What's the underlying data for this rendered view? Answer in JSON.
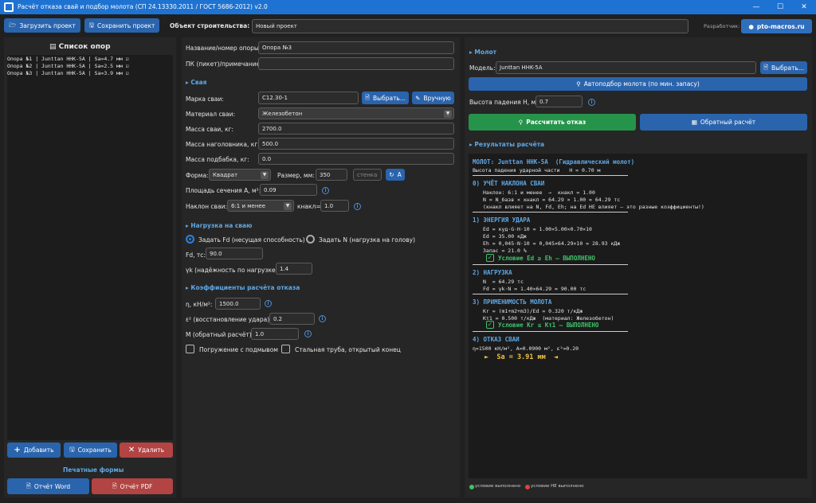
{
  "window": {
    "title": "Расчёт отказа свай и подбор молота (СП 24.13330.2011 / ГОСТ 5686-2012) v2.0",
    "minimize": "—",
    "maximize": "☐",
    "close": "✕"
  },
  "toolbar": {
    "load_label": "Загрузить проект",
    "save_label": "Сохранить проект",
    "object_label": "Объект строительства:",
    "object_value": "Новый проект",
    "dev_label": "Разработчик:",
    "site_label": "pto-macros.ru"
  },
  "left": {
    "title": "Список опор",
    "items": [
      {
        "text": "Опора №1 | Junttan HHK-5A | Sa=4.7 мм"
      },
      {
        "text": "Опора №2 | Junttan HHK-5A | Sa=2.5 мм"
      },
      {
        "text": "Опора №3 | Junttan HHK-5A | Sa=3.9 мм"
      }
    ],
    "add_label": "Добавить",
    "save_label": "Сохранить",
    "delete_label": "Удалить",
    "print_title": "Печатные формы",
    "word_label": "Отчёт Word",
    "pdf_label": "Отчёт PDF"
  },
  "middle": {
    "name_label": "Название/номер опоры:",
    "name_value": "Опора №3",
    "pk_label": "ПК (пикет)/примечание:",
    "pk_value": "",
    "pile_section": "▸ Свая",
    "brand_label": "Марка сваи:",
    "brand_value": "С12.30-1",
    "choose_label": "Выбрать...",
    "manual_label": "Вручную",
    "material_label": "Материал сваи:",
    "material_value": "Железобетон",
    "mass_label": "Масса сваи, кг:",
    "mass_value": "2700.0",
    "cap_label": "Масса наголовника, кг:",
    "cap_value": "500.0",
    "pad_label": "Масса подбабка, кг:",
    "pad_value": "0.0",
    "shape_label": "Форма:",
    "shape_value": "Квадрат",
    "size_label": "Размер, мм:",
    "size_value": "350",
    "wall_placeholder": "стенка",
    "area_btn": "A",
    "area_label": "Площадь сечения A, м²:",
    "area_value": "0.09",
    "tilt_label": "Наклон сваи:",
    "tilt_value": "6:1 и менее",
    "ktilt_label": "кнакл=",
    "ktilt_value": "1.0",
    "load_section": "▸ Нагрузка на сваю",
    "radio_fd": "Задать Fd (несущая способность)",
    "radio_n": "Задать N (нагрузка на голову)",
    "fd_label": "Fd, тс:",
    "fd_value": "90.0",
    "gk_label": "γk (надёжность по нагрузке):",
    "gk_value": "1.4",
    "coef_section": "▸ Коэффициенты расчёта отказа",
    "eta_label": "η, кН/м²:",
    "eta_value": "1500.0",
    "eps_label": "ε² (восстановление удара):",
    "eps_value": "0.2",
    "m_label": "M (обратный расчёт):",
    "m_value": "1.0",
    "chk_wash": "Погружение с подмывом",
    "chk_pipe": "Стальная труба, открытый конец"
  },
  "right": {
    "hammer_section": "▸ Молот",
    "model_label": "Модель:",
    "model_value": "Junttan HHK-5A",
    "choose_label": "Выбрать...",
    "auto_label": "Автоподбор молота (по мин. запасу)",
    "height_label": "Высота падения H, м:",
    "height_value": "0.7",
    "calc_label": "Рассчитать отказ",
    "reverse_label": "Обратный расчёт",
    "results_section": "▸ Результаты расчёта",
    "legend_ok": "условие выполнено",
    "legend_fail": "условие НЕ выполнено",
    "colors": {
      "ok": "#3fc26a",
      "fail": "#d94444",
      "accent": "#5fa8e6"
    }
  },
  "results": {
    "head1": "МОЛОТ: Junttan HHK-5A  (Гидравлический молот)",
    "head2": "Высота падения ударной части   H = 0.70 м",
    "s0": "0) УЧЁТ НАКЛОНА СВАИ",
    "s0l1": "Наклон: 6:1 и менее  →  кнакл = 1.00",
    "s0l2": "N = N_базв × кнакл = 64.29 × 1.00 = 64.29 тс",
    "s0l3": "(кнакл влияет на N, Fd, Eh; на Ed НЕ влияет — это разные коэффициенты!)",
    "s1": "1) ЭНЕРГИЯ УДАРА",
    "s1l1": "Ed = куд·G·H·10 = 1.00×5.00×0.70×10",
    "s1l2": "Ed = 35.00 кДж",
    "s1l3": "Eh = 0,045·N·10 = 0,045×64.29×10 = 28.93 кДж",
    "s1l4": "Запас = 21.0 %",
    "s1ok": "Условие Ed ≥ Eh — ВЫПОЛНЕНО",
    "s2": "2) НАГРУЗКА",
    "s2l1": "N  = 64.29 тс",
    "s2l2": "Fd = γk·N = 1.40×64.29 = 90.00 тс",
    "s3": "3) ПРИМЕНИМОСТЬ МОЛОТА",
    "s3l1": "Кr = (m1+m2+m3)/Ed = 0.320 т/кДж",
    "s3l2": "Кτ1 = 0.500 т/кДж  (материал: Железобетон)",
    "s3ok": "Условие Кr ≤ Кτ1 — ВЫПОЛНЕНО",
    "s4": "4) ОТКАЗ СВАИ",
    "s4l1": "η=1500 кН/м², A=0.0900 м², ε²=0.20",
    "s4res": "►  Sa = 3.91 мм  ◄"
  }
}
